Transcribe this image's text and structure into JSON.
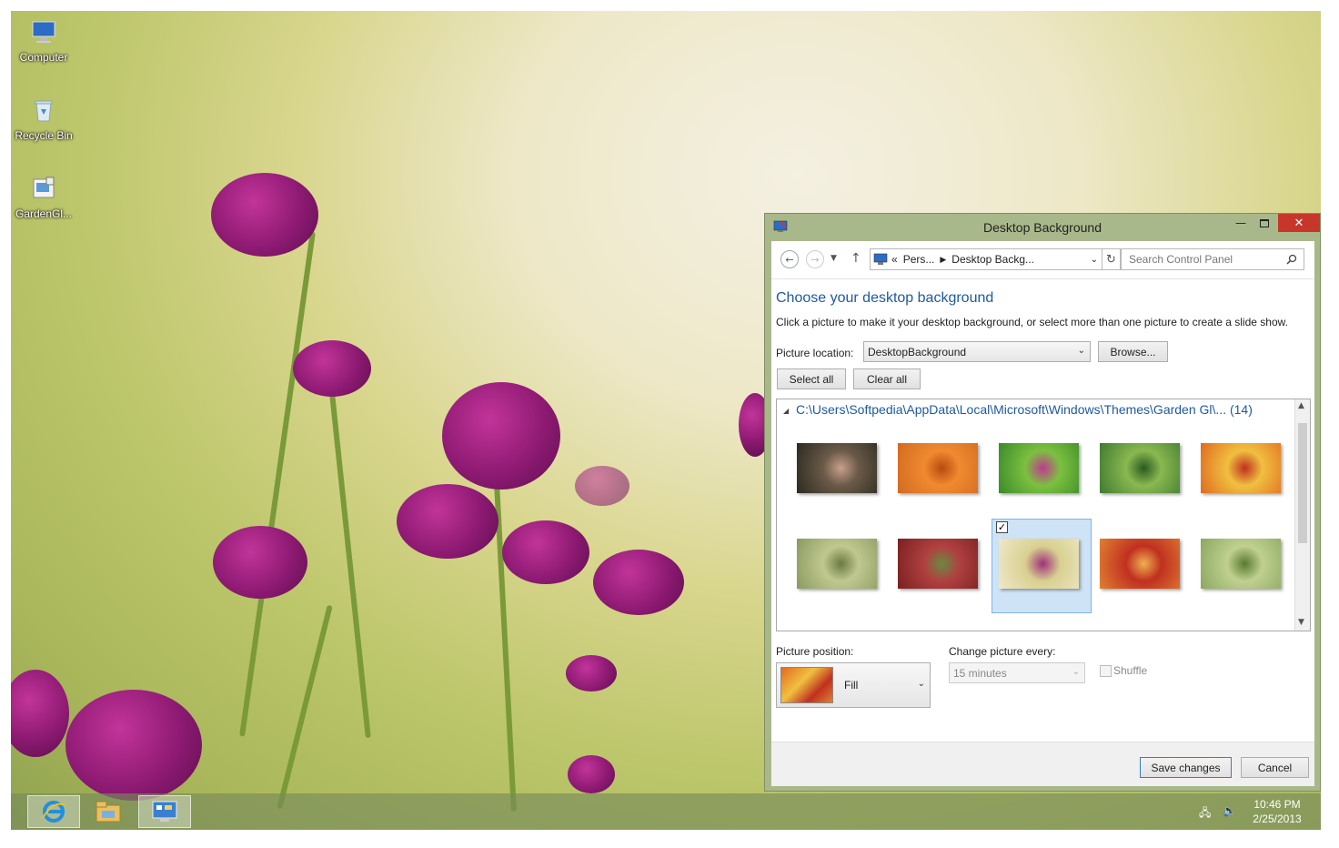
{
  "desktop": {
    "icons": [
      {
        "label": "Computer",
        "icon": "computer-icon"
      },
      {
        "label": "Recycle Bin",
        "icon": "recycle-bin-icon"
      },
      {
        "label": "GardenGl...",
        "icon": "theme-pack-icon"
      }
    ]
  },
  "window": {
    "title": "Desktop Background",
    "nav": {
      "breadcrumb_prefix": "«",
      "crumb1": "Pers...",
      "crumb2": "Desktop Backg...",
      "search_placeholder": "Search Control Panel"
    },
    "heading": "Choose your desktop background",
    "description": "Click a picture to make it your desktop background, or select more than one picture to create a slide show.",
    "picture_location_label": "Picture location:",
    "picture_location_value": "DesktopBackground",
    "browse_label": "Browse...",
    "select_all_label": "Select all",
    "clear_all_label": "Clear all",
    "folder_path": "C:\\Users\\Softpedia\\AppData\\Local\\Microsoft\\Windows\\Themes\\Garden Gl\\... (14)",
    "thumbnails": [
      {
        "colors": [
          "#2a2a20",
          "#6b5a48",
          "#c8a08c"
        ],
        "selected": false
      },
      {
        "colors": [
          "#d26a20",
          "#f08a30",
          "#b84a10"
        ],
        "selected": false
      },
      {
        "colors": [
          "#3a8a2a",
          "#7cc040",
          "#c03a90"
        ],
        "selected": false
      },
      {
        "colors": [
          "#3f7a30",
          "#8ab850",
          "#2a5a20"
        ],
        "selected": false
      },
      {
        "colors": [
          "#e06a20",
          "#f0c040",
          "#c03020"
        ],
        "selected": false
      },
      {
        "colors": [
          "#8a9a60",
          "#c0c890",
          "#6a7a40"
        ],
        "selected": false
      },
      {
        "colors": [
          "#7a2020",
          "#b04040",
          "#6a8a40"
        ],
        "selected": false
      },
      {
        "colors": [
          "#efe8c8",
          "#d8d090",
          "#a0307a"
        ],
        "selected": true
      },
      {
        "colors": [
          "#e08030",
          "#c03020",
          "#f0b050"
        ],
        "selected": false
      },
      {
        "colors": [
          "#8aa860",
          "#c0d090",
          "#5a7a30"
        ],
        "selected": false
      }
    ],
    "picture_position_label": "Picture position:",
    "picture_position_value": "Fill",
    "change_picture_label": "Change picture every:",
    "change_picture_value": "15 minutes",
    "shuffle_label": "Shuffle",
    "save_label": "Save changes",
    "cancel_label": "Cancel"
  },
  "taskbar": {
    "time": "10:46 PM",
    "date": "2/25/2013"
  }
}
